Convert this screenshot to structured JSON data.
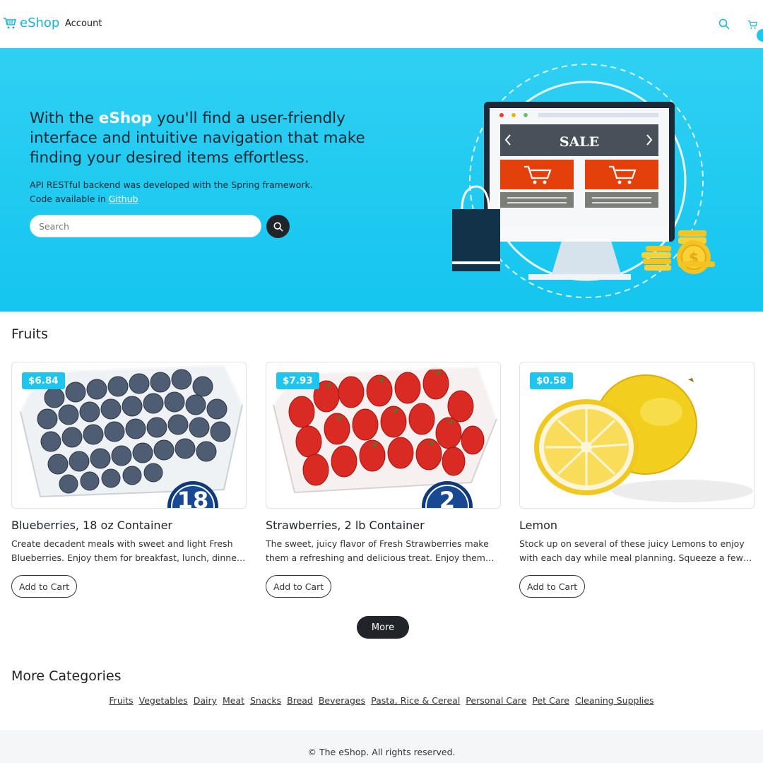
{
  "navbar": {
    "brand": "eShop",
    "account_label": "Account",
    "icons": [
      "cart-icon",
      "search-icon",
      "cart-icon"
    ]
  },
  "hero": {
    "title_prefix": "With the ",
    "title_brand": "eShop",
    "title_suffix": " you'll find a user-friendly interface and intuitive navigation that make finding your desired items effortless.",
    "desc_line1": "API RESTful backend was developed with the Spring framework.",
    "desc_line2_prefix": "Code available in ",
    "github_link": "Github",
    "search_placeholder": "Search",
    "illustration_sale": "SALE"
  },
  "fruits": {
    "title": "Fruits",
    "products": [
      {
        "price": "$6.84",
        "name": "Blueberries, 18 oz Container",
        "description": "Create decadent meals with sweet and light Fresh Blueberries. Enjoy them for breakfast, lunch, dinner, or...",
        "size_badge": "18",
        "button": "Add to Cart"
      },
      {
        "price": "$7.93",
        "name": "Strawberries, 2 lb Container",
        "description": "The sweet, juicy flavor of Fresh Strawberries make them a refreshing and delicious treat. Enjoy them for...",
        "size_badge": "2",
        "button": "Add to Cart"
      },
      {
        "price": "$0.58",
        "name": "Lemon",
        "description": "Stock up on several of these juicy Lemons to enjoy with each day while meal planning. Squeeze a few to make...",
        "button": "Add to Cart"
      }
    ],
    "more_button": "More"
  },
  "categories": {
    "title": "More Categories",
    "links": [
      "Fruits",
      "Vegetables",
      "Dairy",
      "Meat",
      "Snacks",
      "Bread",
      "Beverages",
      "Pasta, Rice & Cereal",
      "Personal Care",
      "Pet Care",
      "Cleaning Supplies"
    ]
  },
  "footer": {
    "text": "© The eShop. All rights reserved."
  },
  "colors": {
    "accent": "#1ec5ef",
    "hero_bg": "#15c5ef",
    "dark": "#212529"
  }
}
